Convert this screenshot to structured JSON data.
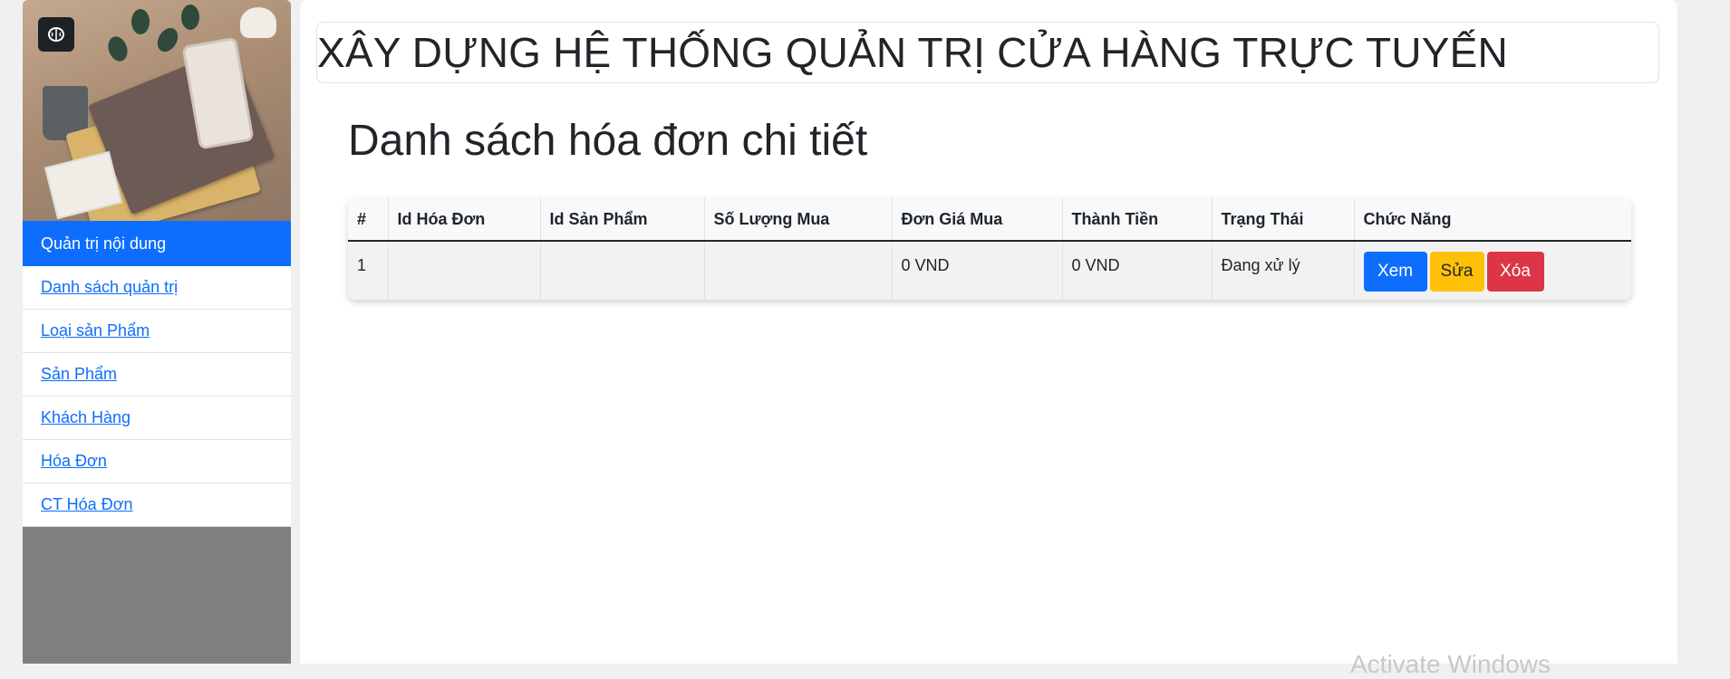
{
  "header": {
    "title": "XÂY DỰNG HỆ THỐNG QUẢN TRỊ CỬA HÀNG TRỰC TUYẾN"
  },
  "sidebar": {
    "brand_icon": "brain-icon",
    "items": [
      {
        "label": "Quản trị nội dung",
        "active": true
      },
      {
        "label": "Danh sách quản trị"
      },
      {
        "label": "Loại sản Phẩm"
      },
      {
        "label": "Sản Phẩm"
      },
      {
        "label": "Khách Hàng"
      },
      {
        "label": "Hóa Đơn"
      },
      {
        "label": "CT Hóa Đơn"
      }
    ]
  },
  "main": {
    "page_title": "Danh sách hóa đơn chi tiết",
    "table": {
      "columns": [
        "#",
        "Id Hóa Đơn",
        "Id Sản Phẩm",
        "Số Lượng Mua",
        "Đơn Giá Mua",
        "Thành Tiền",
        "Trạng Thái",
        "Chức Năng"
      ],
      "rows": [
        {
          "cells": [
            "1",
            "",
            "",
            "",
            "0 VND",
            "0 VND",
            "Đang xử lý"
          ],
          "actions": {
            "view": "Xem",
            "edit": "Sửa",
            "delete": "Xóa"
          }
        }
      ]
    }
  },
  "watermark": "Activate Windows",
  "colors": {
    "primary": "#0d6efd",
    "warning": "#ffc107",
    "danger": "#dc3545"
  }
}
